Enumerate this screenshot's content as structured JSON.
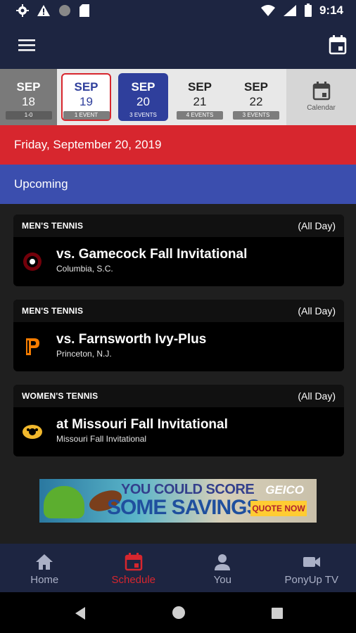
{
  "status_bar": {
    "time": "9:14"
  },
  "date_strip": {
    "days": [
      {
        "month": "SEP",
        "day": "18",
        "badge": "1-0"
      },
      {
        "month": "SEP",
        "day": "19",
        "badge": "1 EVENT"
      },
      {
        "month": "SEP",
        "day": "20",
        "badge": "3 EVENTS"
      },
      {
        "month": "SEP",
        "day": "21",
        "badge": "4 EVENTS"
      },
      {
        "month": "SEP",
        "day": "22",
        "badge": "3 EVENTS"
      }
    ],
    "calendar_label": "Calendar"
  },
  "selected_date": "Friday, September 20, 2019",
  "section_label": "Upcoming",
  "events": [
    {
      "sport": "MEN'S TENNIS",
      "time": "(All Day)",
      "title": "vs. Gamecock Fall Invitational",
      "location": "Columbia, S.C.",
      "logo_icon": "south-carolina-logo-icon"
    },
    {
      "sport": "MEN'S TENNIS",
      "time": "(All Day)",
      "title": "vs. Farnsworth Ivy-Plus",
      "location": "Princeton, N.J.",
      "logo_icon": "princeton-logo-icon"
    },
    {
      "sport": "WOMEN'S TENNIS",
      "time": "(All Day)",
      "title": "at Missouri Fall Invitational",
      "location": "Missouri Fall Invitational",
      "logo_icon": "missouri-logo-icon"
    }
  ],
  "ad": {
    "line1": "YOU COULD SCORE",
    "line2": "SOME SAVINGS",
    "brand": "GEICO",
    "cta": "QUOTE NOW"
  },
  "bottom_nav": [
    {
      "label": "Home",
      "icon": "home-icon"
    },
    {
      "label": "Schedule",
      "icon": "schedule-icon",
      "active": true
    },
    {
      "label": "You",
      "icon": "person-icon"
    },
    {
      "label": "PonyUp TV",
      "icon": "video-camera-icon"
    }
  ],
  "colors": {
    "navy": "#1d2541",
    "red": "#d7262e",
    "blue": "#3b4eae",
    "selected_blue": "#2f3f9c"
  }
}
